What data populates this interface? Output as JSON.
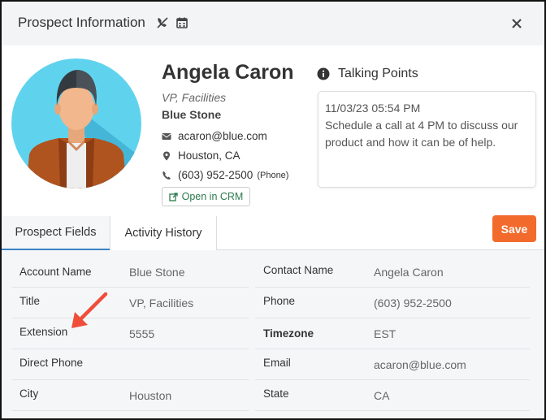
{
  "header": {
    "title": "Prospect Information",
    "icons": [
      "phone-slash-icon",
      "calendar-icon"
    ],
    "close_icon": "close-icon"
  },
  "prospect": {
    "name": "Angela Caron",
    "title": "VP, Facilities",
    "company": "Blue Stone",
    "email": "acaron@blue.com",
    "location": "Houston, CA",
    "phone": "(603) 952-2500",
    "phone_type": "(Phone)",
    "crm_label": "Open in CRM"
  },
  "talking_points": {
    "title": "Talking Points",
    "timestamp": "11/03/23 05:54 PM",
    "text": "Schedule a call at 4 PM to discuss our product and how it can be of help."
  },
  "tabs": [
    {
      "label": "Prospect Fields",
      "active": true
    },
    {
      "label": "Activity History",
      "active": false
    }
  ],
  "save_label": "Save",
  "fields_left": [
    {
      "label": "Account Name",
      "value": "Blue Stone"
    },
    {
      "label": "Title",
      "value": "VP, Facilities"
    },
    {
      "label": "Extension",
      "value": "5555"
    },
    {
      "label": "Direct Phone",
      "value": ""
    },
    {
      "label": "City",
      "value": "Houston"
    }
  ],
  "fields_right": [
    {
      "label": "Contact Name",
      "value": "Angela Caron"
    },
    {
      "label": "Phone",
      "value": "(603) 952-2500"
    },
    {
      "label": "Timezone",
      "value": "EST"
    },
    {
      "label": "Email",
      "value": "acaron@blue.com"
    },
    {
      "label": "State",
      "value": "CA"
    }
  ],
  "colors": {
    "accent_orange": "#f26a2c",
    "tab_underline": "#3b82c4",
    "crm_green": "#2c7a4b",
    "arrow_red": "#ef4e3a",
    "avatar_bg": "#5fd3ee"
  }
}
